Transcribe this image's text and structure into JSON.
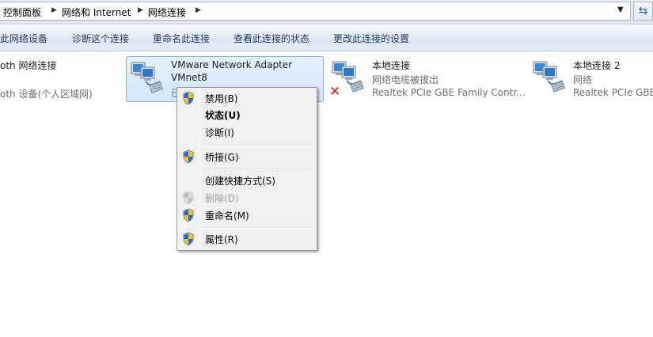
{
  "address_bar": {
    "crumbs": [
      "控制面板",
      "网络和 Internet",
      "网络连接"
    ],
    "refresh_icon": "refresh-icon"
  },
  "toolbar": {
    "items": [
      "此网络设备",
      "诊断这个连接",
      "重命名此连接",
      "查看此连接的状态",
      "更改此连接的设置"
    ]
  },
  "connections": [
    {
      "name": "oth 网络连接",
      "sub1": "",
      "sub2": "oth 设备(个人区域网)",
      "icon": "network-adapter-icon"
    },
    {
      "name": "VMware Network Adapter",
      "sub1": "VMnet8",
      "sub2": "已",
      "icon": "network-adapter-icon",
      "selected": true
    },
    {
      "name": "本地连接",
      "sub1": "网络电缆被拔出",
      "sub2": "Realtek PCIe GBE Family Contr...",
      "icon": "network-adapter-disconnected-icon"
    },
    {
      "name": "本地连接 2",
      "sub1": "网络",
      "sub2": "Realtek PCIe GBE",
      "icon": "network-adapter-icon"
    }
  ],
  "context_menu": {
    "items": [
      {
        "label": "禁用(B)",
        "shield": true
      },
      {
        "label": "状态(U)",
        "bold": true
      },
      {
        "label": "诊断(I)"
      },
      {
        "label": "桥接(G)",
        "shield": true
      },
      {
        "label": "创建快捷方式(S)"
      },
      {
        "label": "删除(D)",
        "shield": true,
        "disabled": true
      },
      {
        "label": "重命名(M)",
        "shield": true
      },
      {
        "label": "属性(R)",
        "shield": true
      }
    ]
  },
  "colors": {
    "toolbar_text": "#1e395b",
    "selection_border": "#84acdd",
    "disconnected_x": "#d4161b"
  }
}
